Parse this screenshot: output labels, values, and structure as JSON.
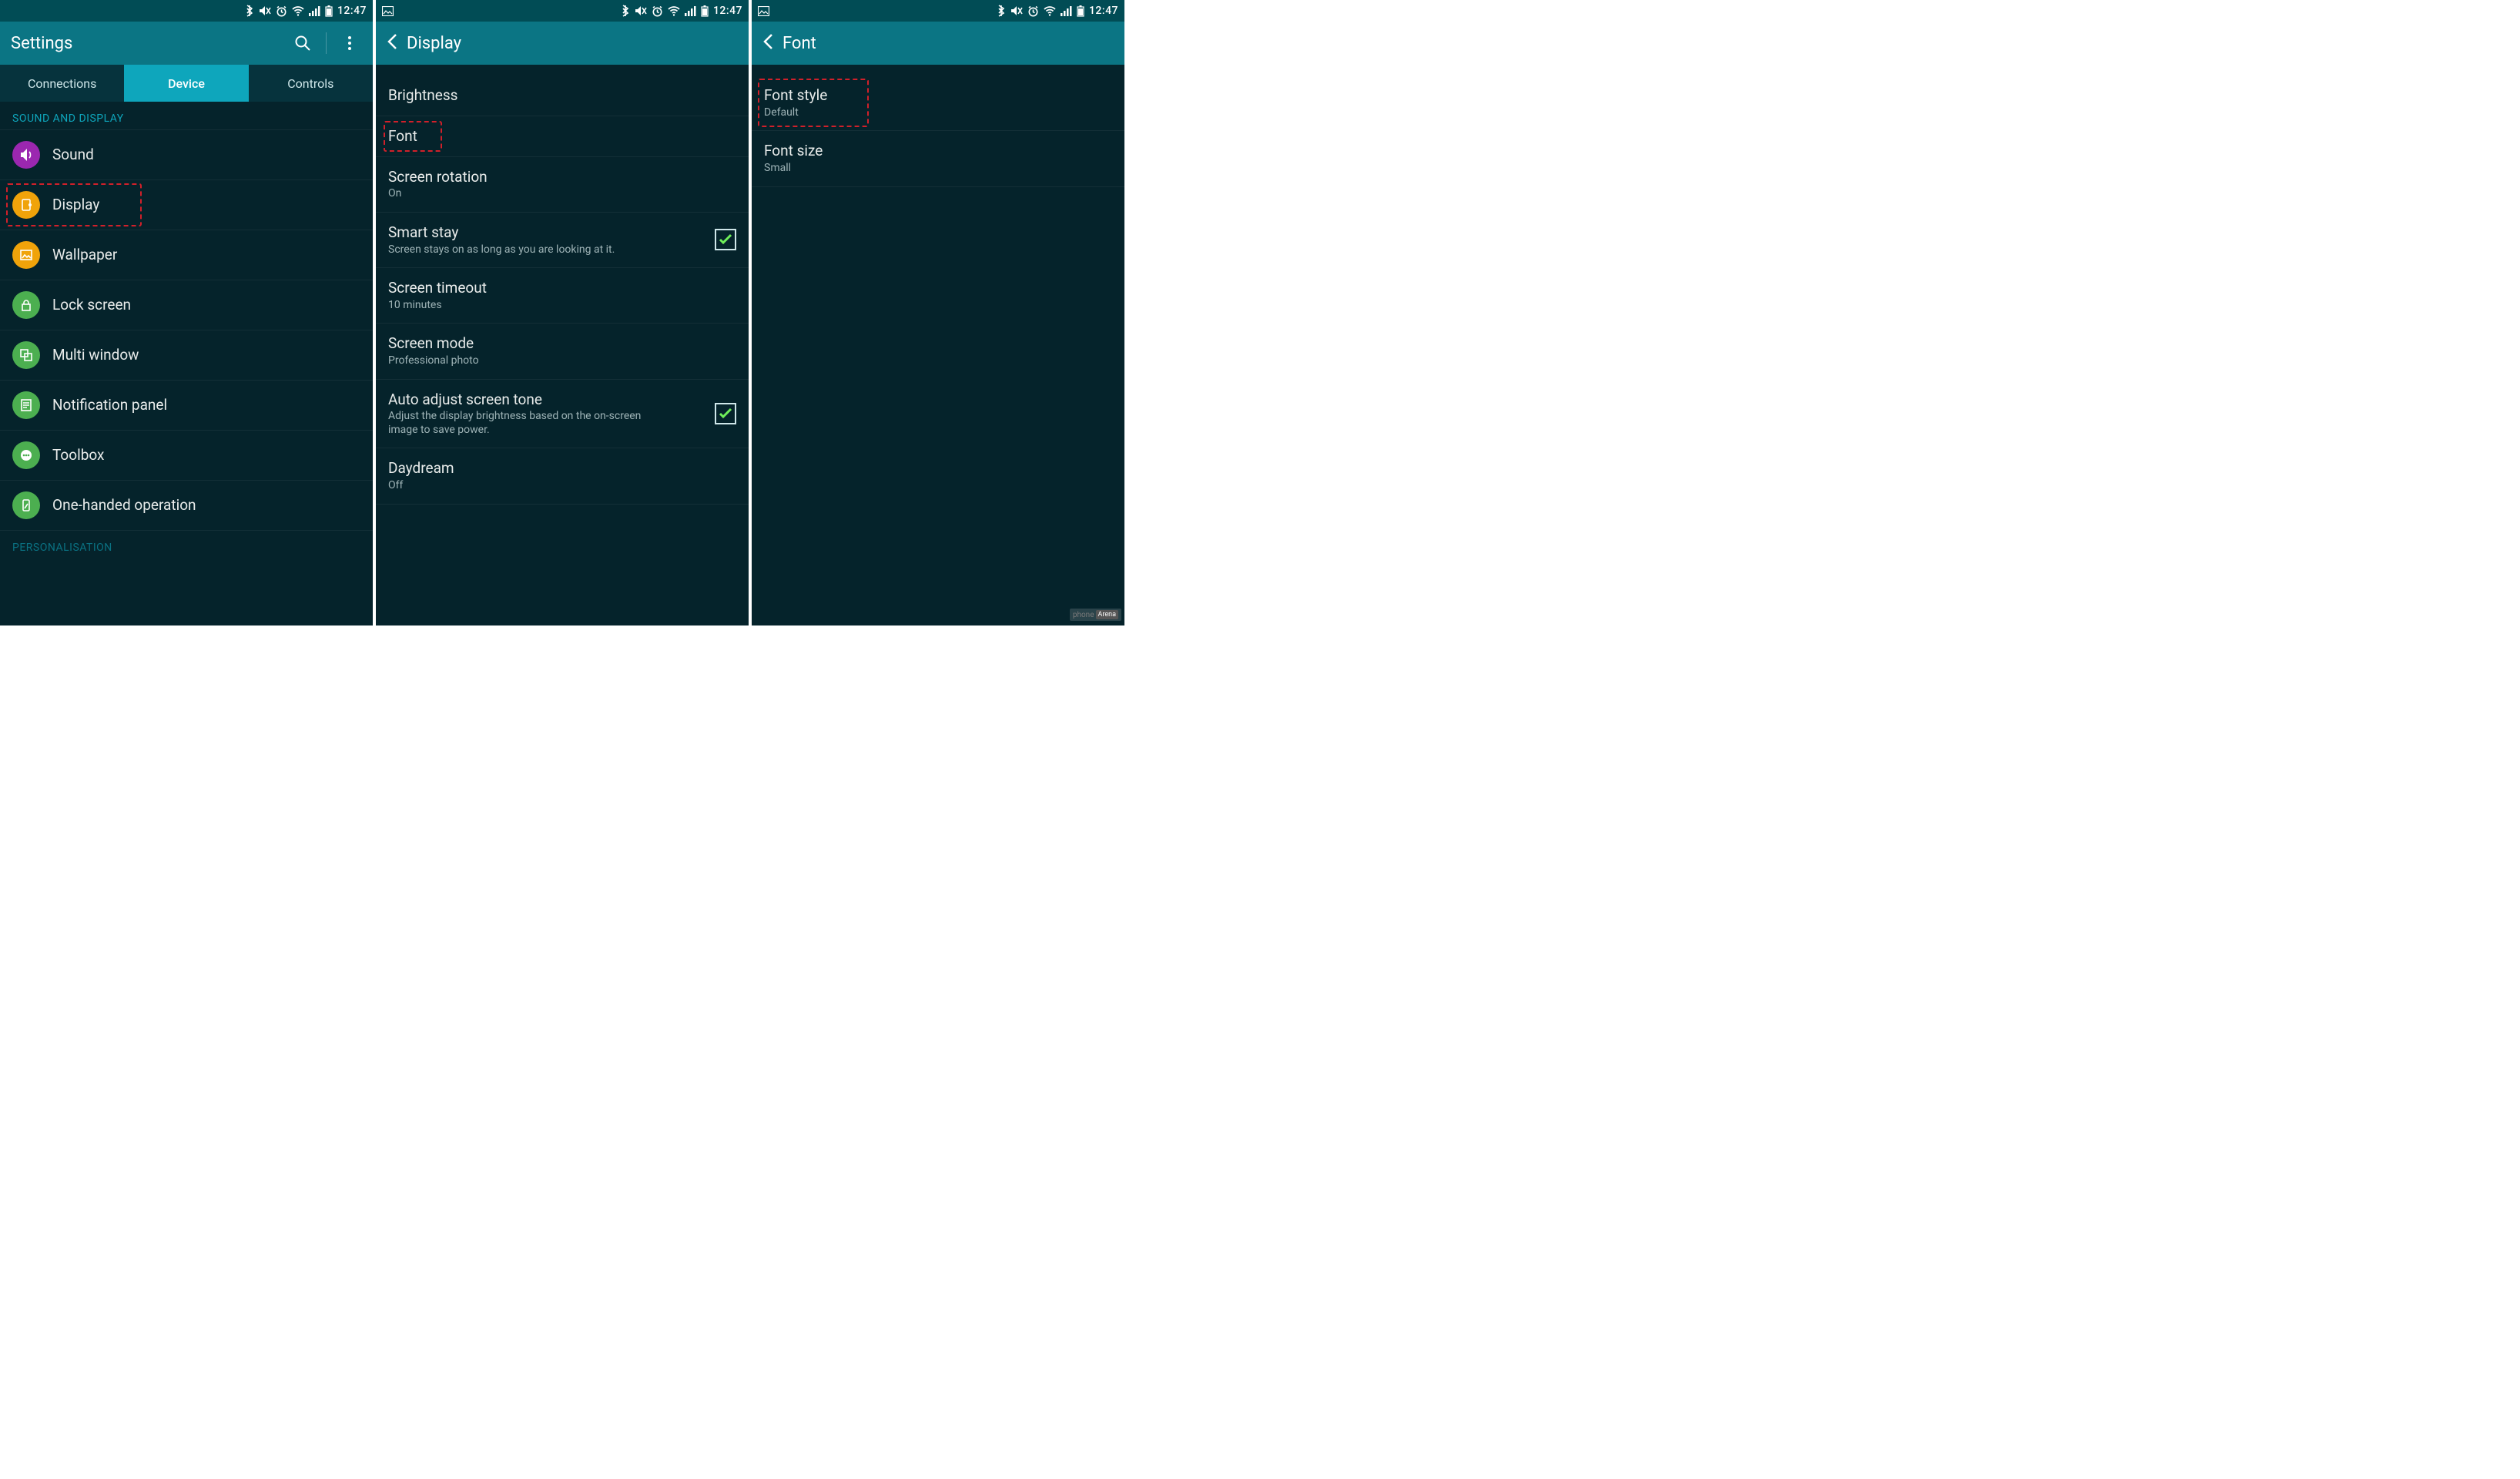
{
  "status": {
    "time": "12:47"
  },
  "screens": {
    "settings": {
      "title": "Settings",
      "tabs": [
        "Connections",
        "Device",
        "Controls"
      ],
      "activeTab": 1,
      "sectionHeader": "SOUND AND DISPLAY",
      "items": [
        {
          "label": "Sound",
          "iconColor": "ic-purple",
          "iconName": "sound-icon"
        },
        {
          "label": "Display",
          "iconColor": "ic-orange",
          "iconName": "display-icon",
          "highlight": true
        },
        {
          "label": "Wallpaper",
          "iconColor": "ic-orange",
          "iconName": "wallpaper-icon"
        },
        {
          "label": "Lock screen",
          "iconColor": "ic-green",
          "iconName": "lock-screen-icon"
        },
        {
          "label": "Multi window",
          "iconColor": "ic-green",
          "iconName": "multi-window-icon"
        },
        {
          "label": "Notification panel",
          "iconColor": "ic-green",
          "iconName": "notification-panel-icon"
        },
        {
          "label": "Toolbox",
          "iconColor": "ic-green",
          "iconName": "toolbox-icon"
        },
        {
          "label": "One-handed operation",
          "iconColor": "ic-green",
          "iconName": "one-handed-icon"
        }
      ],
      "sectionFooter": "PERSONALISATION"
    },
    "display": {
      "title": "Display",
      "items": [
        {
          "label": "Brightness"
        },
        {
          "label": "Font",
          "highlight": true,
          "narrowHighlight": true
        },
        {
          "label": "Screen rotation",
          "sub": "On"
        },
        {
          "label": "Smart stay",
          "sub": "Screen stays on as long as you are looking at it.",
          "checked": true
        },
        {
          "label": "Screen timeout",
          "sub": "10 minutes"
        },
        {
          "label": "Screen mode",
          "sub": "Professional photo"
        },
        {
          "label": "Auto adjust screen tone",
          "sub": "Adjust the display brightness based on the on-screen image to save power.",
          "checked": true
        },
        {
          "label": "Daydream",
          "sub": "Off"
        }
      ]
    },
    "font": {
      "title": "Font",
      "items": [
        {
          "label": "Font style",
          "sub": "Default",
          "highlight": true
        },
        {
          "label": "Font size",
          "sub": "Small"
        }
      ]
    }
  },
  "watermark": {
    "text1": "phone",
    "text2": "Arena"
  }
}
